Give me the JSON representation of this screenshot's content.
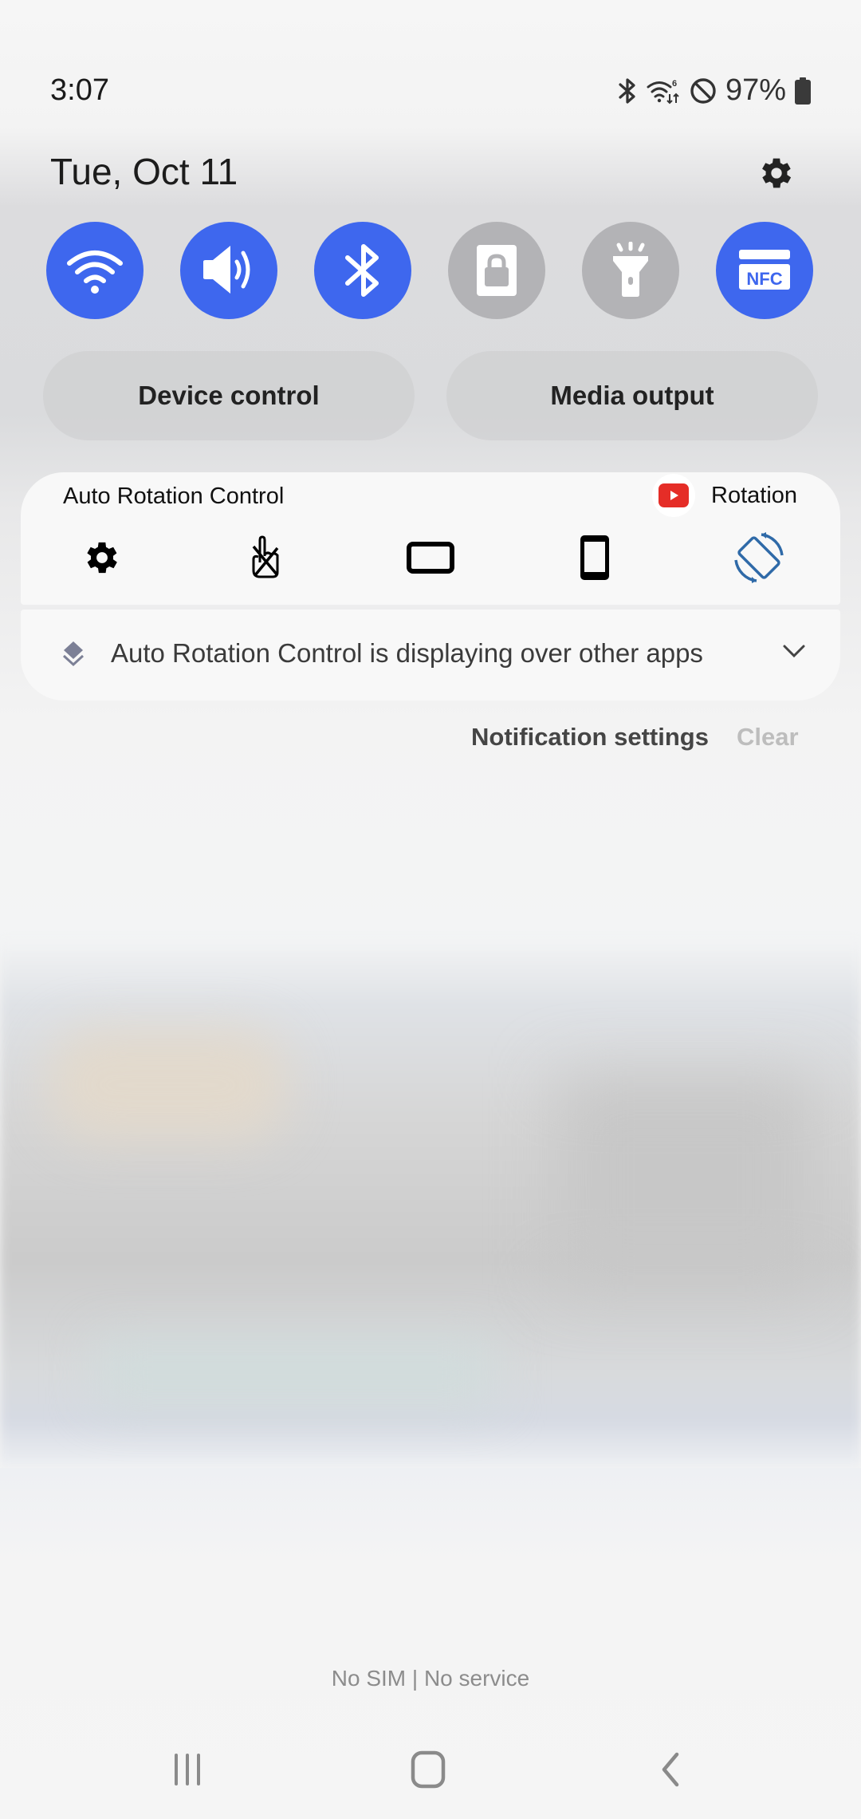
{
  "status_bar": {
    "time": "3:07",
    "battery_percent": "97%",
    "icons": [
      "bluetooth-icon",
      "wifi-data-icon",
      "do-not-disturb-icon",
      "battery-icon"
    ]
  },
  "header": {
    "date": "Tue, Oct 11",
    "settings_icon": "gear-icon"
  },
  "quick_toggles": [
    {
      "name": "Wi-Fi",
      "icon": "wifi-icon",
      "state": "on"
    },
    {
      "name": "Sound",
      "icon": "volume-icon",
      "state": "on"
    },
    {
      "name": "Bluetooth",
      "icon": "bluetooth-icon",
      "state": "on"
    },
    {
      "name": "Secure Folder",
      "icon": "lock-icon",
      "state": "off"
    },
    {
      "name": "Flashlight",
      "icon": "flashlight-icon",
      "state": "off"
    },
    {
      "name": "NFC",
      "icon": "nfc-icon",
      "state": "on",
      "badge": "NFC"
    }
  ],
  "pills": {
    "device_control": "Device control",
    "media_output": "Media output"
  },
  "notification": {
    "app_title": "Auto Rotation Control",
    "current_app_label": "Rotation",
    "controls": [
      {
        "icon": "gear-icon",
        "label": "Settings"
      },
      {
        "icon": "touch-blocked-icon",
        "label": "Disable touch"
      },
      {
        "icon": "landscape-icon",
        "label": "Landscape"
      },
      {
        "icon": "portrait-icon",
        "label": "Portrait"
      },
      {
        "icon": "auto-rotate-icon",
        "label": "Auto rotate"
      }
    ],
    "system_message": "Auto Rotation Control is displaying over other apps"
  },
  "actions": {
    "notification_settings": "Notification settings",
    "clear": "Clear"
  },
  "carrier": "No SIM | No service",
  "colors": {
    "accent": "#3e67ee",
    "toggle_off": "#b3b3b6",
    "rotate_icon": "#2f6aa8",
    "youtube_red": "#e52d27"
  }
}
